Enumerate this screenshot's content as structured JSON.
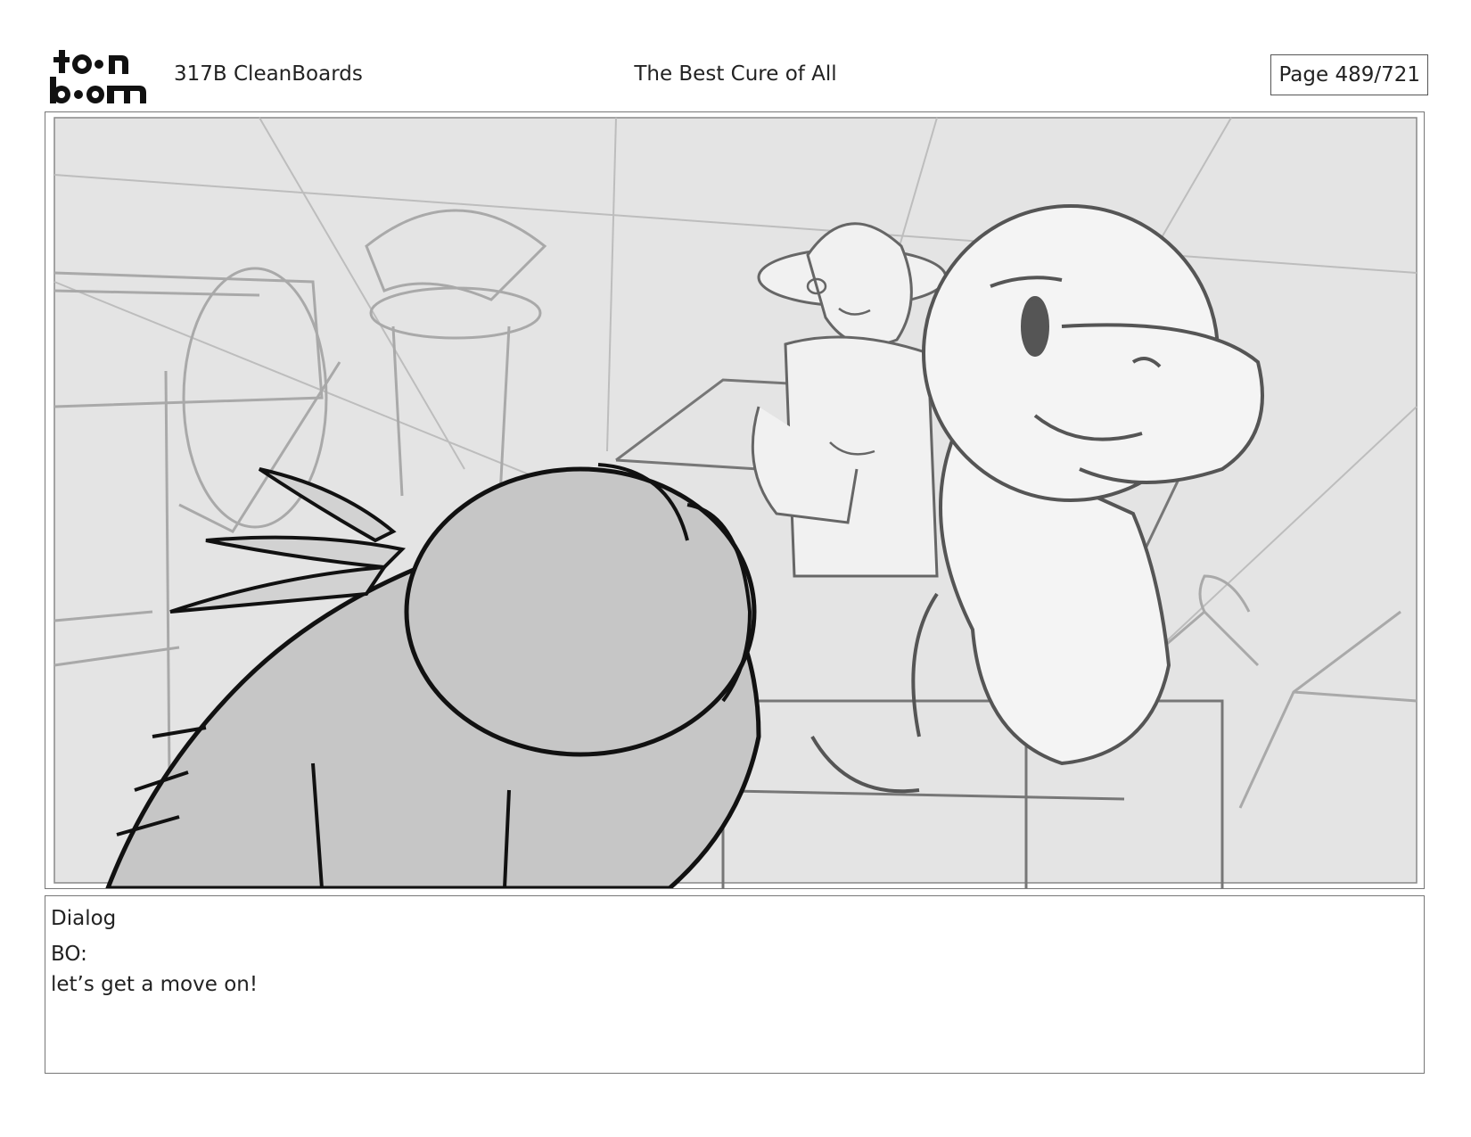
{
  "header": {
    "logo_text": "toon boom",
    "project": "317B  CleanBoards",
    "title": "The Best Cure of All",
    "page": "Page 489/721"
  },
  "panel": {
    "image_alt": ""
  },
  "dialog": {
    "label": "Dialog",
    "speaker": "BO:",
    "line": "let’s get a move on!"
  }
}
